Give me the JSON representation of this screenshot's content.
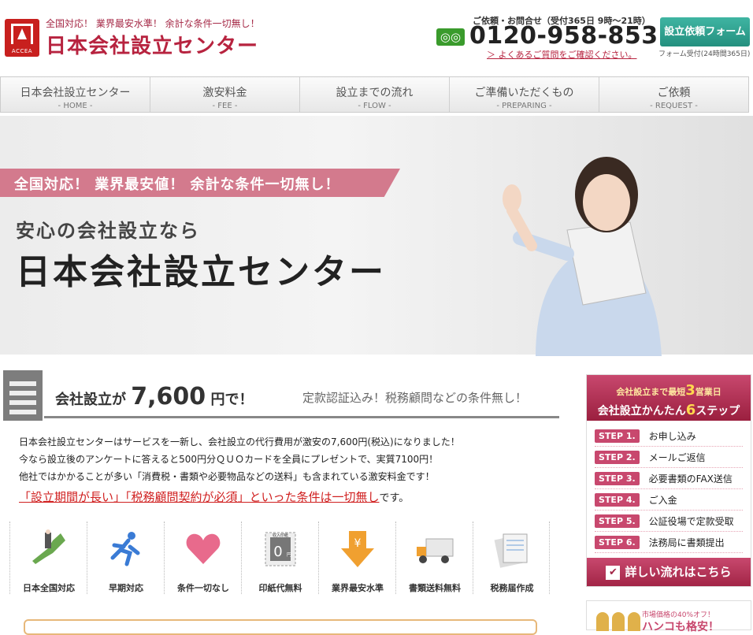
{
  "header": {
    "catch": "全国対応！ 業界最安水準！ 余計な条件一切無し！",
    "logo_name": "日本会社設立センター",
    "logo_mark": "ACCEA",
    "tel_label": "ご依頼・お問合せ（受付365日 9時～21時）",
    "freedial": "◎◎",
    "tel": "0120-958-853",
    "faq_link": "＞ よくあるご質問をご確認ください。",
    "request_button": "設立依頼フォーム",
    "request_note": "フォーム受付(24時間365日)"
  },
  "nav": [
    {
      "jp": "日本会社設立センター",
      "en": "- HOME -"
    },
    {
      "jp": "激安料金",
      "en": "- FEE -"
    },
    {
      "jp": "設立までの流れ",
      "en": "- FLOW -"
    },
    {
      "jp": "ご準備いただくもの",
      "en": "- PREPARING -"
    },
    {
      "jp": "ご依頼",
      "en": "- REQUEST -"
    }
  ],
  "hero": {
    "ribbon": "全国対応！ 業界最安値！ 余計な条件一切無し！",
    "sub": "安心の会社設立なら",
    "title": "日本会社設立センター"
  },
  "price": {
    "head_pre": "会社設立が ",
    "amount": "7,600",
    "head_post": " 円で！",
    "note": "定款認証込み！税務顧問などの条件無し！"
  },
  "body_lines": [
    "日本会社設立センターはサービスを一新し、会社設立の代行費用が激安の7,600円(税込)になりました！",
    "今なら設立後のアンケートに答えると500円分ＱＵＯカードを全員にプレゼントで、実質7100円！",
    "他社ではかかることが多い「消費税・書類や必要物品などの送料」も含まれている激安料金です！"
  ],
  "warning": {
    "main": "「設立期間が長い」「税務顧問契約が必須」といった条件は一切無し",
    "tail": "です。"
  },
  "features": [
    {
      "label": "日本全国対応",
      "icon": "japan-map-icon"
    },
    {
      "label": "早期対応",
      "icon": "running-person-icon"
    },
    {
      "label": "条件一切なし",
      "icon": "heart-icon"
    },
    {
      "label": "印紙代無料",
      "icon": "stamp-icon"
    },
    {
      "label": "業界最安水準",
      "icon": "yen-arrow-icon"
    },
    {
      "label": "書類送料無料",
      "icon": "truck-icon"
    },
    {
      "label": "税務届作成",
      "icon": "document-icon"
    }
  ],
  "stamp_text": {
    "top": "収入印紙",
    "zero": "0",
    "unit": "円"
  },
  "side": {
    "head_a_pre": "会社設立まで最短",
    "head_a_num": "3",
    "head_a_post": "営業日",
    "head_b_pre": "会社設立かんたん",
    "head_b_num": "6",
    "head_b_post": "ステップ",
    "steps": [
      {
        "tag": "STEP 1.",
        "text": "お申し込み"
      },
      {
        "tag": "STEP 2.",
        "text": "メールご返信"
      },
      {
        "tag": "STEP 3.",
        "text": "必要書類のFAX送信"
      },
      {
        "tag": "STEP 4.",
        "text": "ご入金"
      },
      {
        "tag": "STEP 5.",
        "text": "公証役場で定款受取"
      },
      {
        "tag": "STEP 6.",
        "text": "法務局に書類提出"
      }
    ],
    "flow_button": "詳しい流れはこちら"
  },
  "hanko": {
    "pre": "市場価格の40%オフ！",
    "big": "ハンコも格安！"
  },
  "colors": {
    "brand": "#b7233f",
    "accent_teal": "#24907f",
    "pink": "#c8486e",
    "warn": "#d02020"
  }
}
